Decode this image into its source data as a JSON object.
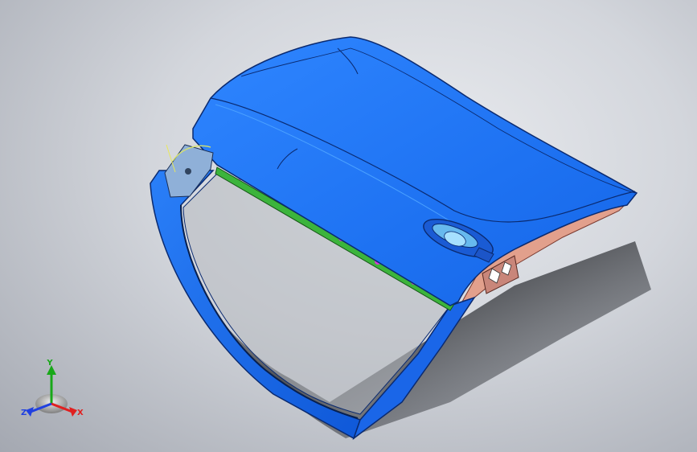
{
  "viewport": {
    "background_center": "#e9ebef",
    "background_edge": "#a4a8b1"
  },
  "model": {
    "panel_color": "#1565e6",
    "panel_highlight": "#2f86ff",
    "inner_panel_color": "#e2a08c",
    "seal_color": "#3cb43c",
    "clip_color": "#d63bd6",
    "handle_color": "#67b9ee"
  },
  "triad": {
    "x_label": "X",
    "y_label": "Y",
    "z_label": "Z",
    "x_color": "#e02020",
    "y_color": "#18a818",
    "z_color": "#2040e0"
  }
}
